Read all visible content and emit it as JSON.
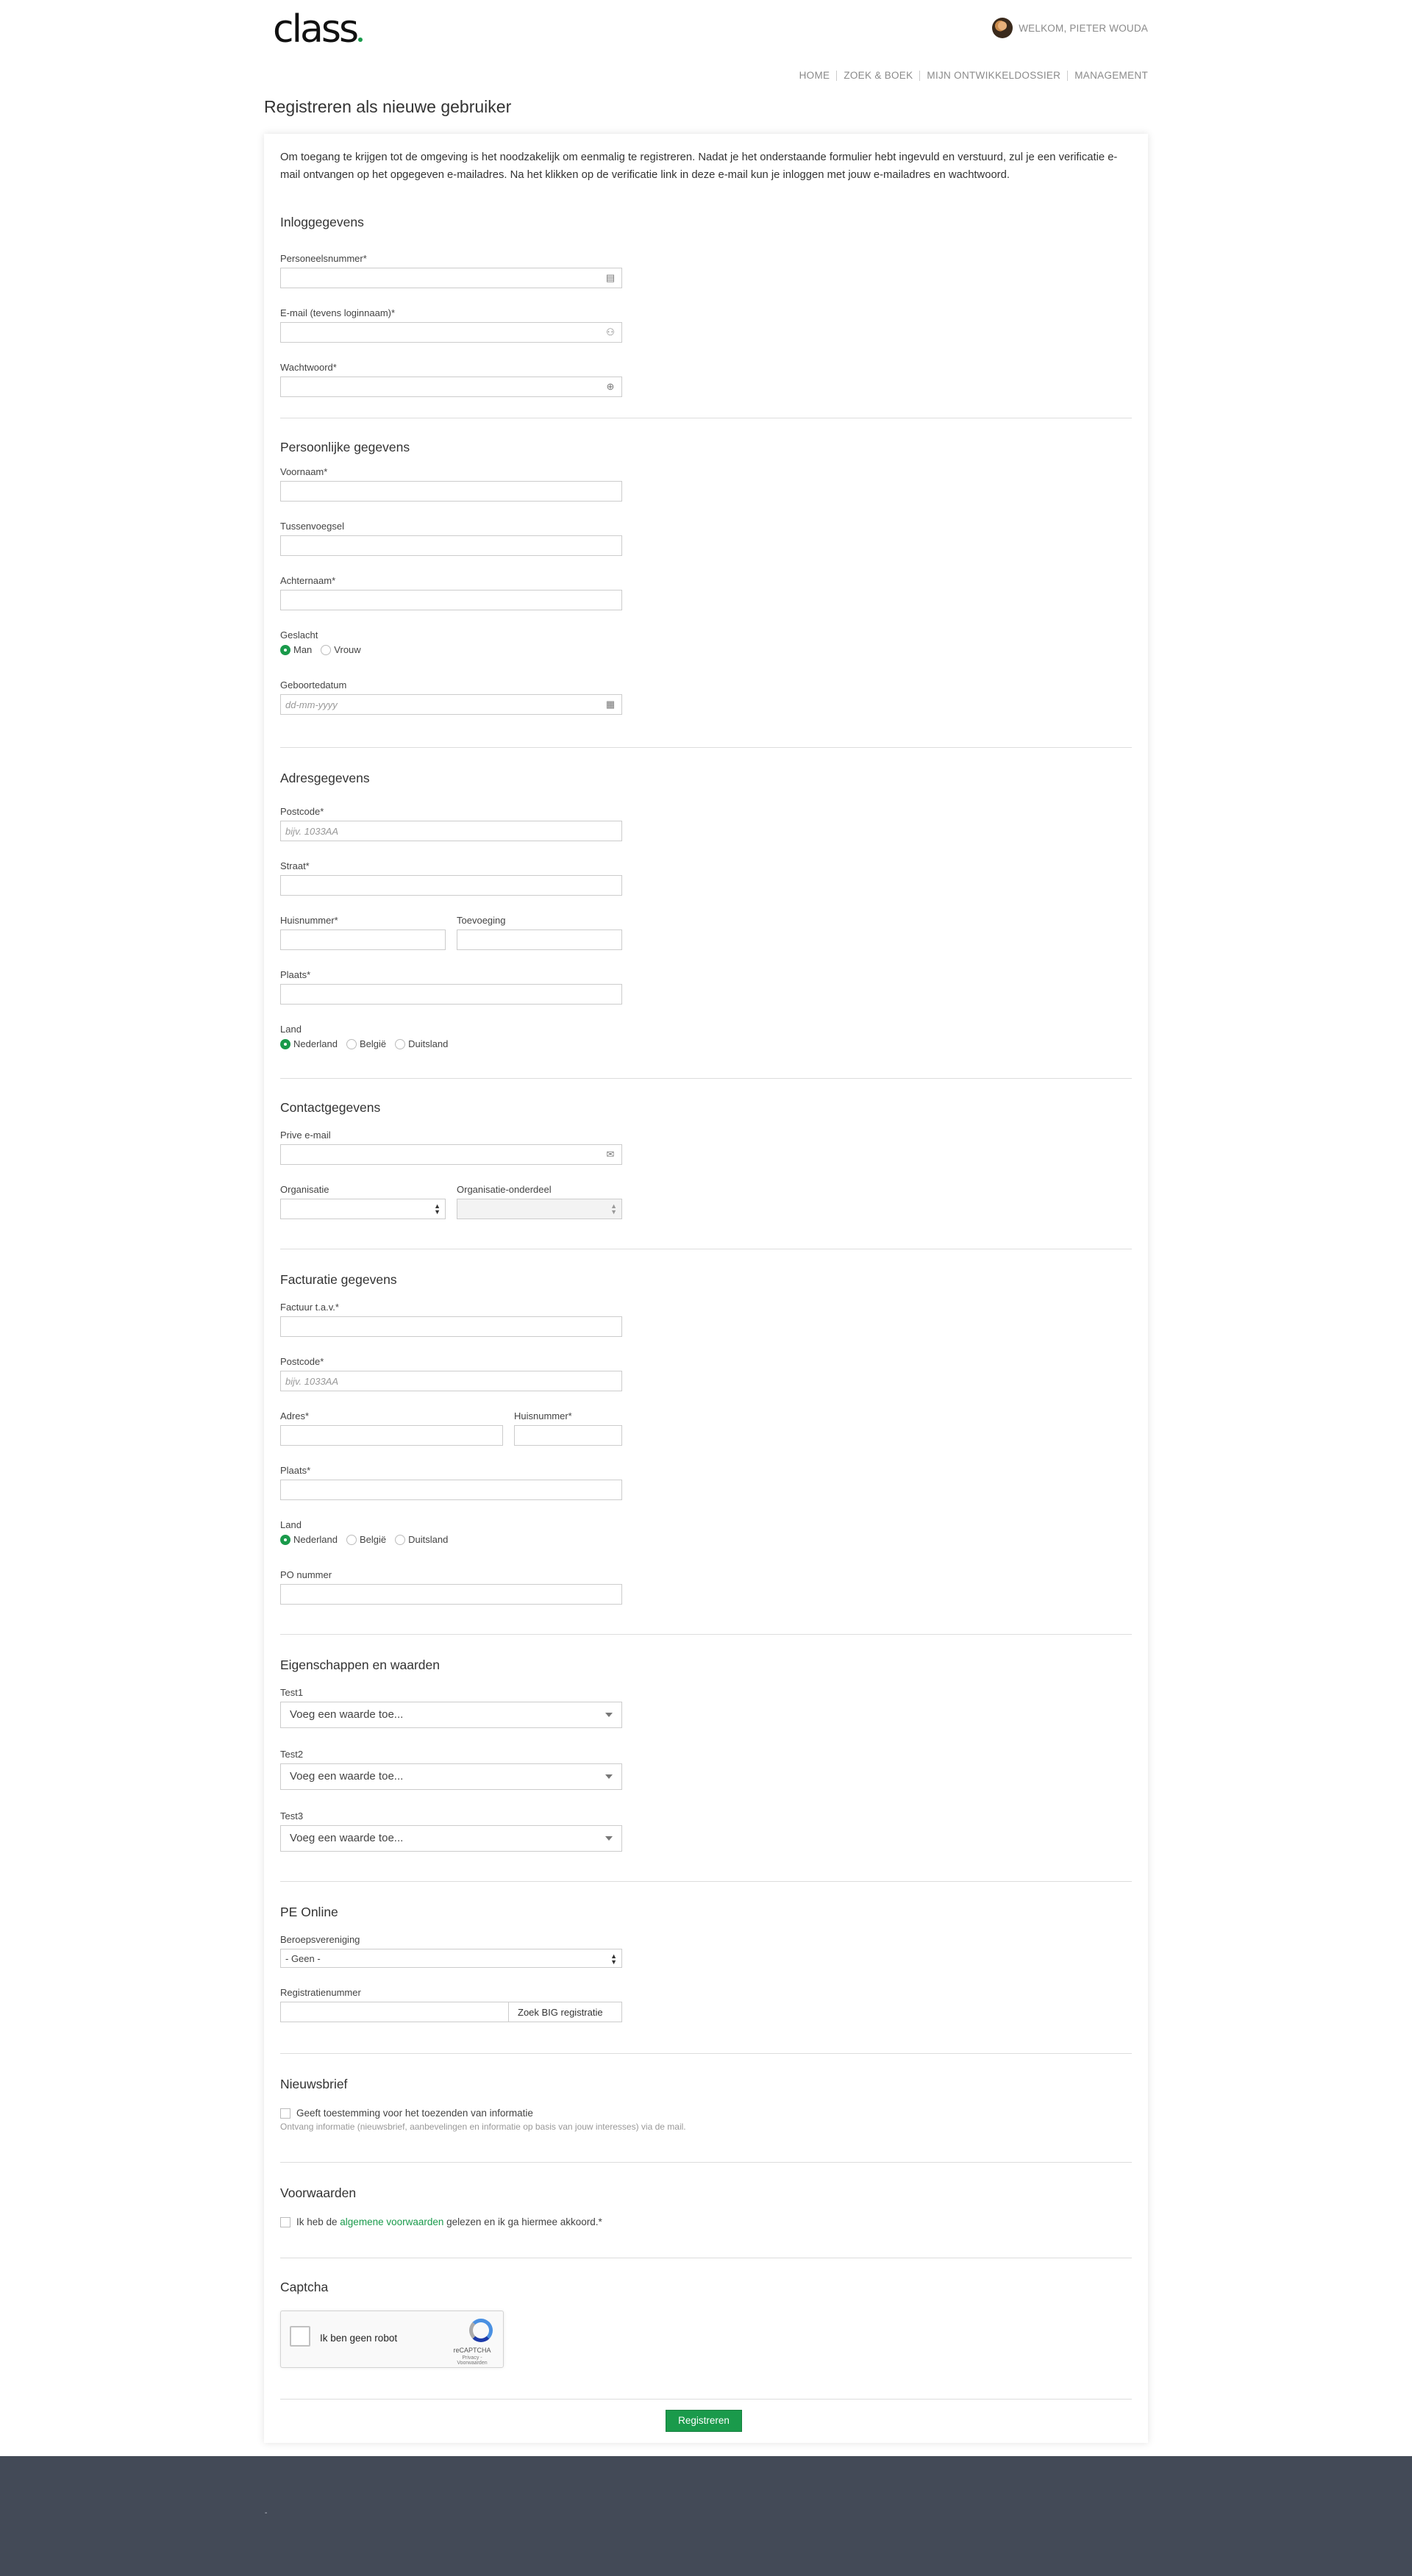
{
  "header": {
    "logo": "class",
    "welcome": "WELKOM, PIETER WOUDA"
  },
  "nav": [
    "HOME",
    "ZOEK & BOEK",
    "MIJN ONTWIKKELDOSSIER",
    "MANAGEMENT"
  ],
  "page_title": "Registreren als nieuwe gebruiker",
  "intro": "Om toegang te krijgen tot de omgeving is het noodzakelijk om eenmalig te registreren. Nadat je het onderstaande formulier hebt ingevuld en verstuurd, zul je een verificatie e-mail ontvangen op het opgegeven e-mailadres. Na het klikken op de verificatie link in deze e-mail kun je inloggen met jouw e-mailadres en wachtwoord.",
  "login": {
    "heading": "Inloggegevens",
    "personnel_label": "Personeelsnummer*",
    "email_label": "E-mail (tevens loginnaam)*",
    "password_label": "Wachtwoord*"
  },
  "personal": {
    "heading": "Persoonlijke gegevens",
    "first_label": "Voornaam*",
    "middle_label": "Tussenvoegsel",
    "last_label": "Achternaam*",
    "gender_label": "Geslacht",
    "gender_male": "Man",
    "gender_female": "Vrouw",
    "gender_selected": "Man",
    "dob_label": "Geboortedatum",
    "dob_placeholder": "dd-mm-yyyy"
  },
  "address": {
    "heading": "Adresgegevens",
    "postcode_label": "Postcode*",
    "postcode_placeholder": "bijv. 1033AA",
    "street_label": "Straat*",
    "number_label": "Huisnummer*",
    "addition_label": "Toevoeging",
    "city_label": "Plaats*",
    "country_label": "Land",
    "countries": [
      "Nederland",
      "België",
      "Duitsland"
    ],
    "country_selected": "Nederland"
  },
  "contact": {
    "heading": "Contactgegevens",
    "private_email_label": "Prive e-mail",
    "org_label": "Organisatie",
    "orgunit_label": "Organisatie-onderdeel"
  },
  "billing": {
    "heading": "Facturatie gegevens",
    "attn_label": "Factuur t.a.v.*",
    "postcode_label": "Postcode*",
    "postcode_placeholder": "bijv. 1033AA",
    "address_label": "Adres*",
    "number_label": "Huisnummer*",
    "city_label": "Plaats*",
    "country_label": "Land",
    "countries": [
      "Nederland",
      "België",
      "Duitsland"
    ],
    "country_selected": "Nederland",
    "po_label": "PO nummer"
  },
  "props": {
    "heading": "Eigenschappen en waarden",
    "items": [
      {
        "label": "Test1",
        "placeholder": "Voeg een waarde toe..."
      },
      {
        "label": "Test2",
        "placeholder": "Voeg een waarde toe..."
      },
      {
        "label": "Test3",
        "placeholder": "Voeg een waarde toe..."
      }
    ]
  },
  "pe": {
    "heading": "PE Online",
    "assoc_label": "Beroepsvereniging",
    "assoc_value": "- Geen -",
    "reg_label": "Registratienummer",
    "search_button": "Zoek BIG registratie"
  },
  "newsletter": {
    "heading": "Nieuwsbrief",
    "consent": "Geeft toestemming voor het toezenden van informatie",
    "help": "Ontvang informatie (nieuwsbrief, aanbevelingen en informatie op basis van jouw interesses) via de mail."
  },
  "terms": {
    "heading": "Voorwaarden",
    "pre": "Ik heb de ",
    "link": "algemene voorwaarden",
    "post": " gelezen en ik ga hiermee akkoord.*"
  },
  "captcha": {
    "heading": "Captcha",
    "label": "Ik ben geen robot",
    "brand": "reCAPTCHA",
    "links": "Privacy - Voorwaarden"
  },
  "submit": "Registreren",
  "footer": {
    "text": "-"
  },
  "colors": {
    "accent": "#1a9a4b",
    "footer_bg": "#434a57"
  }
}
